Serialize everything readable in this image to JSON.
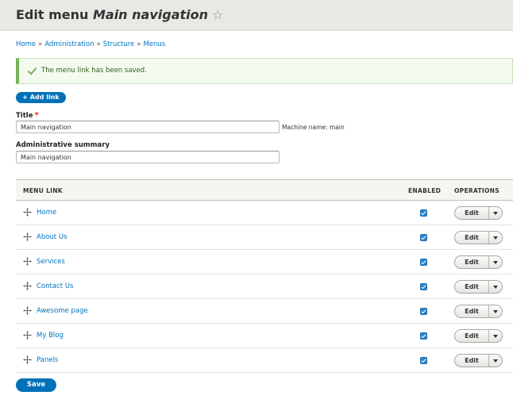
{
  "header": {
    "title_prefix": "Edit menu",
    "title_menu": "Main navigation",
    "shortcut_star": "☆"
  },
  "breadcrumb": [
    "Home",
    "Administration",
    "Structure",
    "Menus"
  ],
  "breadcrumb_separator": "»",
  "status": {
    "message": "The menu link has been saved.",
    "color": "#77b259"
  },
  "add_link_label": "+ Add link",
  "form": {
    "title_label": "Title",
    "title_required_mark": "*",
    "title_value": "Main navigation",
    "machine_name_text": "Machine name: main",
    "summary_label": "Administrative summary",
    "summary_value": "Main navigation"
  },
  "table": {
    "columns": [
      "MENU LINK",
      "ENABLED",
      "OPERATIONS"
    ],
    "rows": [
      {
        "label": "Home",
        "enabled": true,
        "operation": "Edit"
      },
      {
        "label": "About Us",
        "enabled": true,
        "operation": "Edit"
      },
      {
        "label": "Services",
        "enabled": true,
        "operation": "Edit"
      },
      {
        "label": "Contact Us",
        "enabled": true,
        "operation": "Edit"
      },
      {
        "label": "Awesome page",
        "enabled": true,
        "operation": "Edit"
      },
      {
        "label": "My Blog",
        "enabled": true,
        "operation": "Edit"
      },
      {
        "label": "Panels",
        "enabled": true,
        "operation": "Edit"
      }
    ]
  },
  "save_label": "Save",
  "colors": {
    "primary": "#0071b8",
    "link": "#0074bd",
    "header_bg": "#e8e8e5"
  }
}
